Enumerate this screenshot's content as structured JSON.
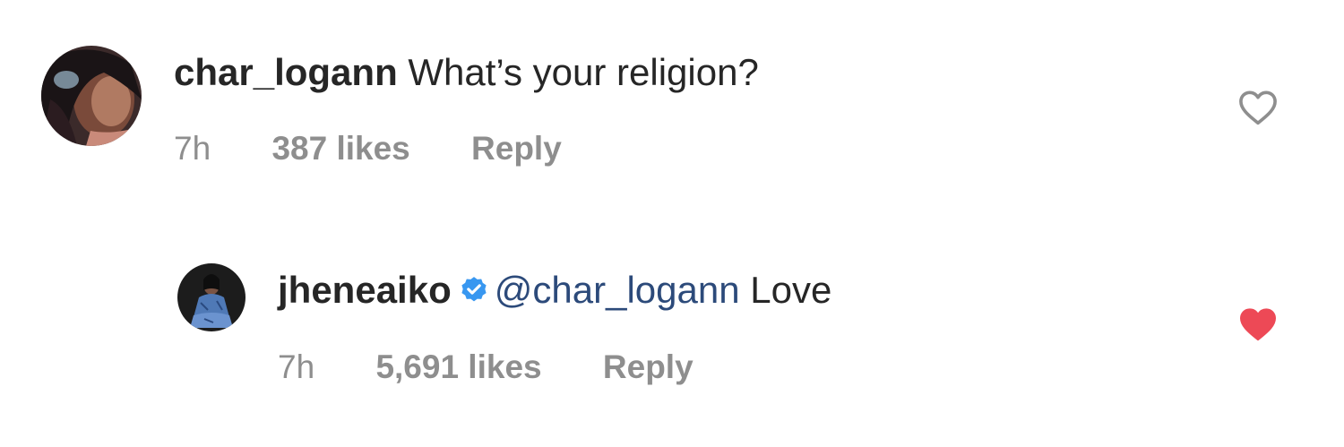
{
  "comments": [
    {
      "username": "char_logann",
      "text": "What’s your religion?",
      "time": "7h",
      "likes": "387 likes",
      "reply_label": "Reply",
      "liked": false
    },
    {
      "username": "jheneaiko",
      "verified": true,
      "mention": "@char_logann",
      "text": "Love",
      "time": "7h",
      "likes": "5,691 likes",
      "reply_label": "Reply",
      "liked": true
    }
  ],
  "colors": {
    "text": "#262626",
    "meta": "#8e8e8e",
    "mention": "#2c4a7a",
    "verified": "#3897f0",
    "heart_liked": "#ed4956",
    "heart_outline": "#8e8e8e"
  },
  "icons": {
    "like_outline": "heart-outline-icon",
    "like_filled": "heart-filled-icon",
    "verified": "verified-badge-icon"
  }
}
